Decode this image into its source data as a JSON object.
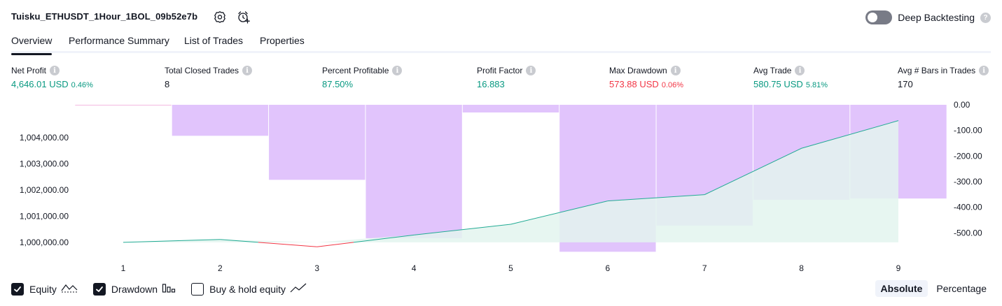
{
  "header": {
    "strategy_name": "Tuisku_ETHUSDT_1Hour_1BOL_09b52e7b",
    "deep_backtesting_label": "Deep Backtesting",
    "deep_backtesting_enabled": false,
    "help_glyph": "?"
  },
  "tabs": [
    {
      "label": "Overview",
      "active": true
    },
    {
      "label": "Performance Summary",
      "active": false
    },
    {
      "label": "List of Trades",
      "active": false
    },
    {
      "label": "Properties",
      "active": false
    }
  ],
  "metrics": {
    "net_profit": {
      "label": "Net Profit",
      "value": "4,646.01 USD",
      "pct": "0.46%"
    },
    "total_closed_trades": {
      "label": "Total Closed Trades",
      "value": "8"
    },
    "percent_profitable": {
      "label": "Percent Profitable",
      "value": "87.50%"
    },
    "profit_factor": {
      "label": "Profit Factor",
      "value": "16.883"
    },
    "max_drawdown": {
      "label": "Max Drawdown",
      "value": "573.88 USD",
      "pct": "0.06%"
    },
    "avg_trade": {
      "label": "Avg Trade",
      "value": "580.75 USD",
      "pct": "5.81%"
    },
    "avg_bars": {
      "label": "Avg # Bars in Trades",
      "value": "170"
    },
    "info_glyph": "i"
  },
  "legend": {
    "equity": {
      "label": "Equity",
      "checked": true
    },
    "drawdown": {
      "label": "Drawdown",
      "checked": true
    },
    "buy_hold": {
      "label": "Buy & hold equity",
      "checked": false
    }
  },
  "mode": {
    "absolute": "Absolute",
    "percentage": "Percentage",
    "active": "Absolute"
  },
  "colors": {
    "equity_up": "#22ab94",
    "equity_down": "#f23645",
    "equity_fill": "#e3f4ef",
    "drawdown_fill": "#e1c4fc",
    "drawdown_edge": "#f2a6d9"
  },
  "chart_data": {
    "type": "area",
    "x": [
      1,
      2,
      3,
      4,
      5,
      6,
      7,
      8,
      9
    ],
    "equity": {
      "name": "Equity",
      "values": [
        1000000,
        1000110,
        999830,
        1000280,
        1000690,
        1001580,
        1001820,
        1003590,
        1004646
      ]
    },
    "drawdown": {
      "name": "Drawdown",
      "bar_edges": [
        0.5,
        1.5,
        2.5,
        3.5,
        4.5,
        5.5,
        6.5,
        7.5,
        8.5,
        9.5
      ],
      "values": [
        0,
        -121,
        -293,
        -521,
        -30,
        -574,
        -472,
        -371,
        -366
      ]
    },
    "left_axis": {
      "ticks": [
        1000000,
        1001000,
        1002000,
        1003000,
        1004000
      ],
      "tick_labels": [
        "1,000,000.00",
        "1,001,000.00",
        "1,002,000.00",
        "1,003,000.00",
        "1,004,000.00"
      ],
      "ylim": [
        999650,
        1005250
      ]
    },
    "right_axis": {
      "ticks": [
        0,
        -100,
        -200,
        -300,
        -400,
        -500
      ],
      "tick_labels": [
        "0.00",
        "-100.00",
        "-200.00",
        "-300.00",
        "-400.00",
        "-500.00"
      ],
      "ylim": [
        -573.88,
        0
      ]
    },
    "x_tick_labels": [
      "1",
      "2",
      "3",
      "4",
      "5",
      "6",
      "7",
      "8",
      "9"
    ],
    "grid": false
  }
}
